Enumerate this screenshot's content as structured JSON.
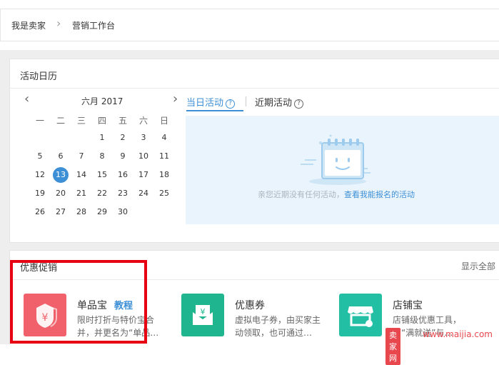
{
  "breadcrumb": {
    "home": "我是卖家",
    "current": "营销工作台"
  },
  "calendar_panel": {
    "title": "活动日历",
    "month_label": "六月  2017",
    "weekdays": [
      "一",
      "二",
      "三",
      "四",
      "五",
      "六",
      "日"
    ],
    "rows": [
      [
        "",
        "",
        "",
        "1",
        "2",
        "3",
        "4"
      ],
      [
        "5",
        "6",
        "7",
        "8",
        "9",
        "10",
        "11"
      ],
      [
        "12",
        "13",
        "14",
        "15",
        "16",
        "17",
        "18"
      ],
      [
        "19",
        "20",
        "21",
        "22",
        "23",
        "24",
        "25"
      ],
      [
        "26",
        "27",
        "28",
        "29",
        "30",
        "",
        ""
      ]
    ],
    "today": "13",
    "tabs": [
      {
        "label": "当日活动"
      },
      {
        "label": "近期活动"
      }
    ],
    "empty_text": "亲您近期没有任何活动，",
    "empty_link": "查看我能报名的活动"
  },
  "promo_panel": {
    "title": "优惠促销",
    "show_all": "显示全部",
    "tools": [
      {
        "name": "单品宝",
        "tutorial": "教程",
        "desc1": "限时打折与特价宝合",
        "desc2": "并，并更名为“单品…",
        "color": "#f0616b",
        "icon": "price-tag-icon"
      },
      {
        "name": "优惠券",
        "desc1": "虚拟电子券，由买家主",
        "desc2": "动领取，也可通过…",
        "color": "#1fb58e",
        "icon": "coupon-envelope-icon"
      },
      {
        "name": "店铺宝",
        "desc1": "店铺级优惠工具，",
        "desc2": "原“满就送”与…",
        "color": "#22bfa5",
        "icon": "shop-icon"
      }
    ]
  },
  "watermark": {
    "badge": "卖家网",
    "url": "www.maijia.com"
  }
}
